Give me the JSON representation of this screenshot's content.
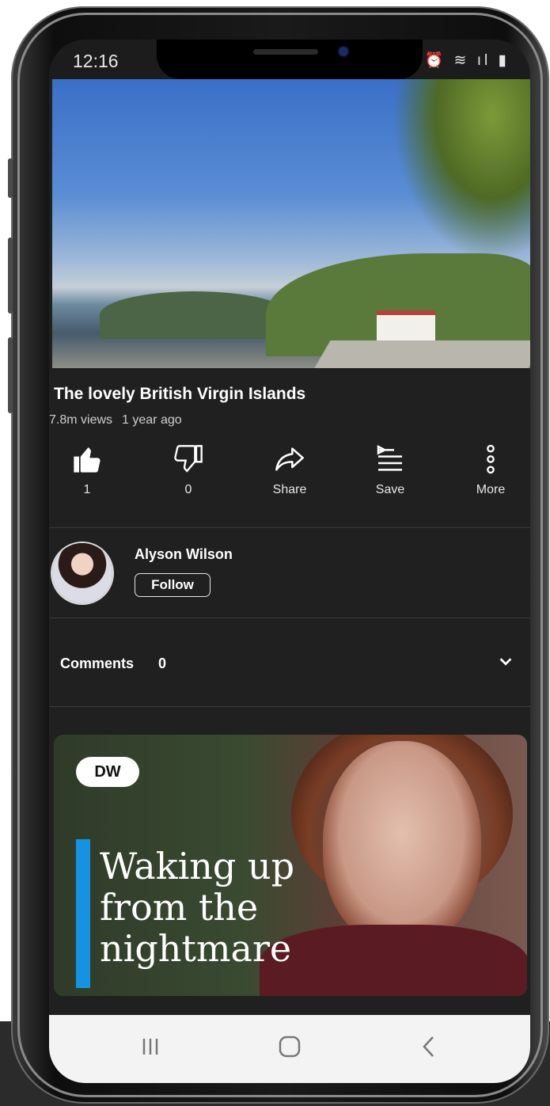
{
  "status_bar": {
    "time": "12:16",
    "icons": [
      "alarm-icon",
      "wifi-icon",
      "signal-icon",
      "battery-icon"
    ],
    "icons_text": "⏰ ≋ ıl ▮"
  },
  "video": {
    "title": "The lovely British Virgin Islands",
    "views": "7.8m views",
    "age": "1 year ago"
  },
  "actions": {
    "like_count": "1",
    "dislike_count": "0",
    "share_label": "Share",
    "save_label": "Save",
    "more_label": "More"
  },
  "channel": {
    "name": "Alyson Wilson",
    "follow_label": "Follow"
  },
  "comments": {
    "label": "Comments",
    "count": "0"
  },
  "next_video": {
    "logo_text": "DW",
    "headline_lines": [
      "Waking up",
      "from the",
      "nightmare"
    ]
  },
  "colors": {
    "background": "#202020",
    "accent_blue": "#1593e2",
    "navbar": "#f3f3f3"
  }
}
